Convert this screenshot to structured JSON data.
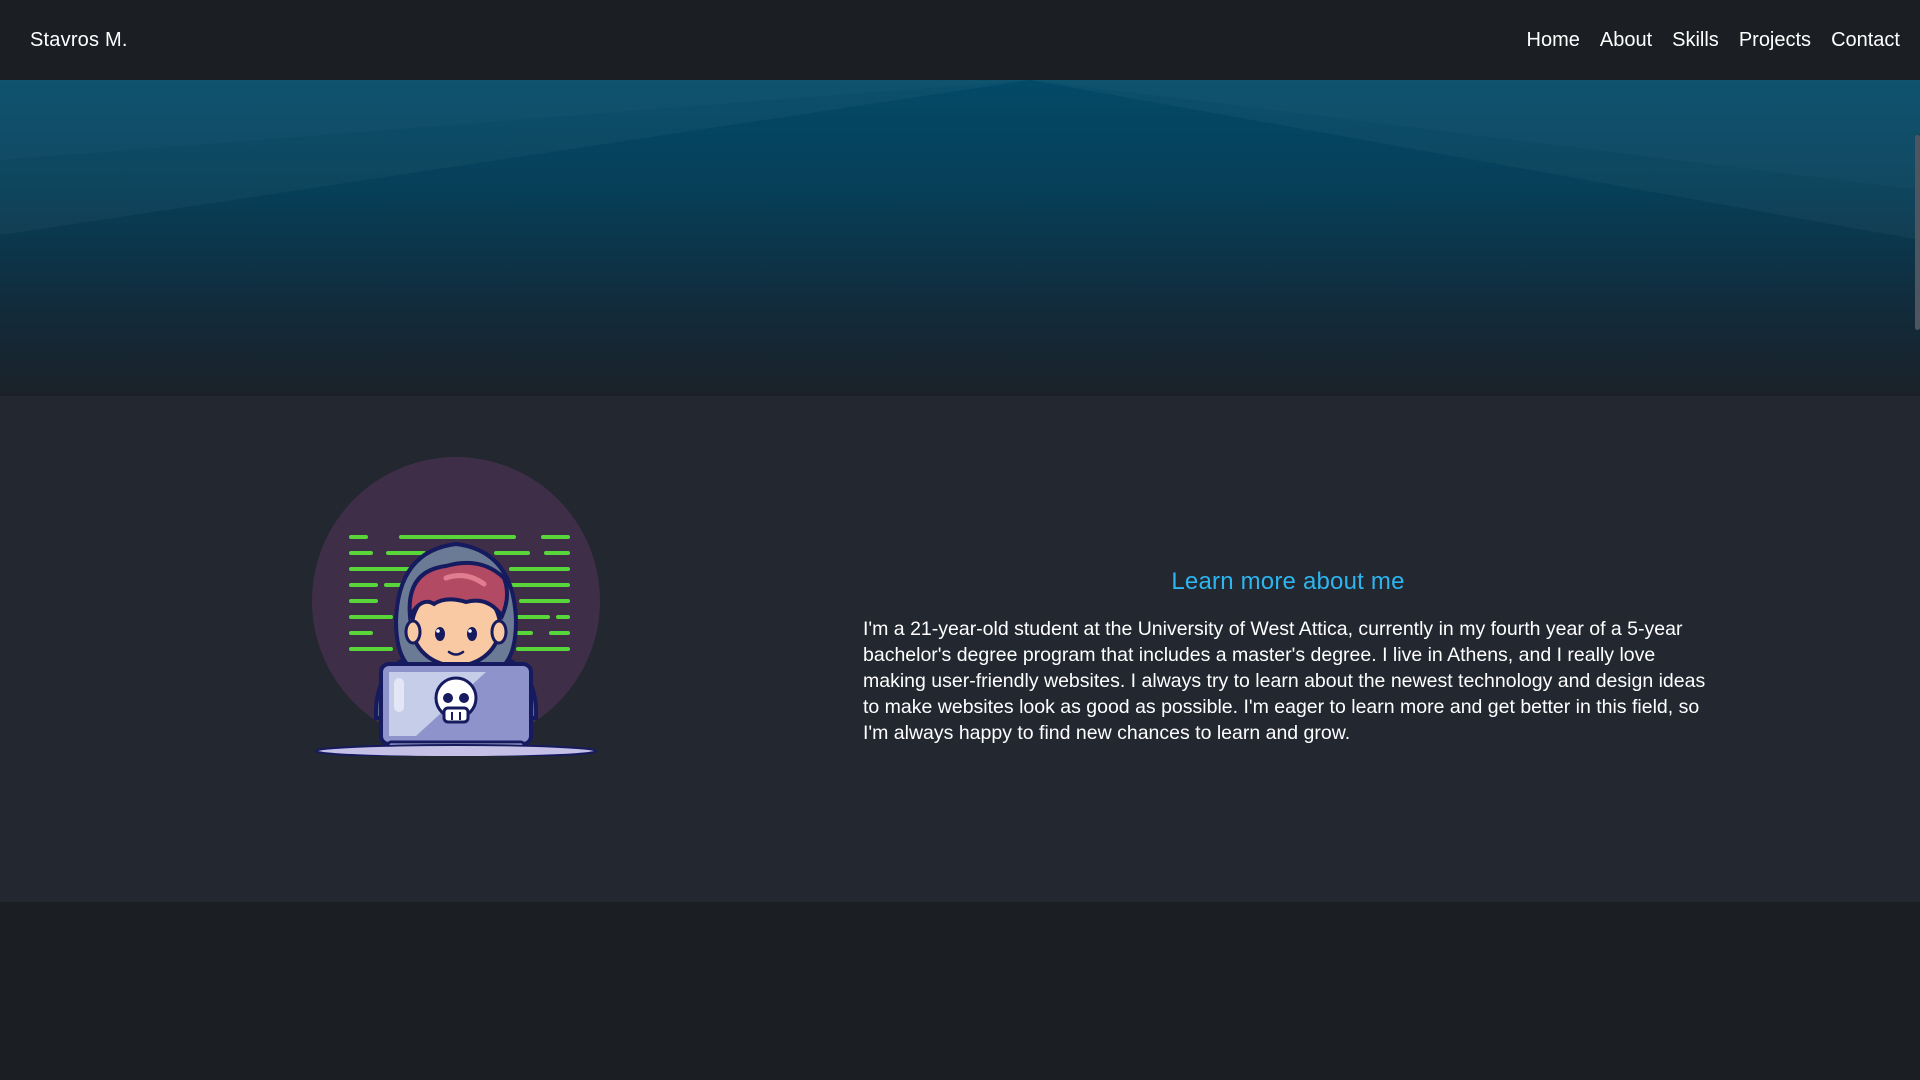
{
  "nav": {
    "brand": "Stavros M.",
    "links": [
      {
        "label": "Home"
      },
      {
        "label": "About"
      },
      {
        "label": "Skills"
      },
      {
        "label": "Projects"
      },
      {
        "label": "Contact"
      }
    ]
  },
  "about": {
    "title": "Learn more about me",
    "paragraph": "I'm a 21-year-old student at the University of West Attica, currently in my fourth year of a 5-year bachelor's degree program that includes a master's degree. I live in Athens, and I really love making user-friendly websites. I always try to learn about the newest technology and design ideas to make websites look as good as possible. I'm eager to learn more and get better in this field, so I'm always happy to find new chances to learn and grow.",
    "illustration": "hacker-with-laptop-illustration"
  },
  "colors": {
    "navbar_bg": "#1b1e23",
    "hero_top": "#034a68",
    "about_bg": "#222730",
    "accent": "#2db5ef",
    "code_lines": "#58d63a"
  }
}
